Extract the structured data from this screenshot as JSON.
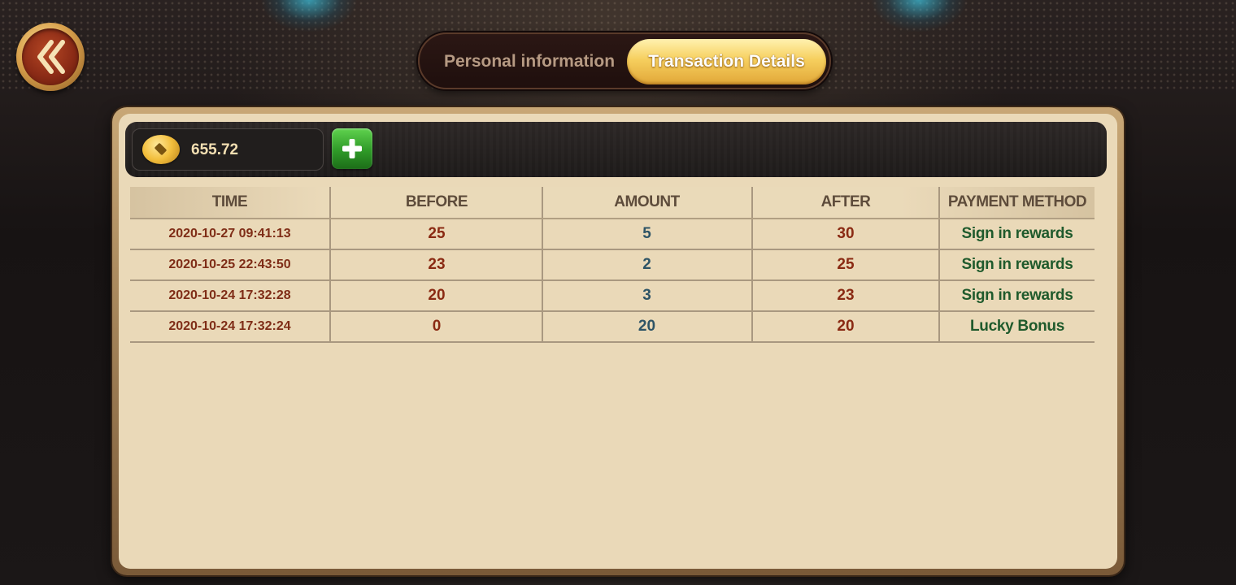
{
  "header": {
    "tabs": [
      {
        "label": "Personal information",
        "active": false
      },
      {
        "label": "Transaction Details",
        "active": true
      }
    ],
    "back_icon": "double-chevron-left-icon"
  },
  "wallet": {
    "balance": "655.72",
    "coin_icon": "gold-coin-icon",
    "add_icon": "plus-icon"
  },
  "table": {
    "columns": [
      "TIME",
      "BEFORE",
      "AMOUNT",
      "AFTER",
      "PAYMENT METHOD"
    ],
    "rows": [
      {
        "time": "2020-10-27 09:41:13",
        "before": "25",
        "amount": "5",
        "after": "30",
        "method": "Sign in rewards"
      },
      {
        "time": "2020-10-25 22:43:50",
        "before": "23",
        "amount": "2",
        "after": "25",
        "method": "Sign in rewards"
      },
      {
        "time": "2020-10-24 17:32:28",
        "before": "20",
        "amount": "3",
        "after": "23",
        "method": "Sign in rewards"
      },
      {
        "time": "2020-10-24 17:32:24",
        "before": "0",
        "amount": "20",
        "after": "20",
        "method": "Lucky Bonus"
      }
    ]
  },
  "colors": {
    "panel_bg": "#ead9b8",
    "accent_gold": "#f6cf5e",
    "value_red": "#8a2a13",
    "amount_blue": "#2e5466",
    "method_green": "#1f5a2c"
  }
}
